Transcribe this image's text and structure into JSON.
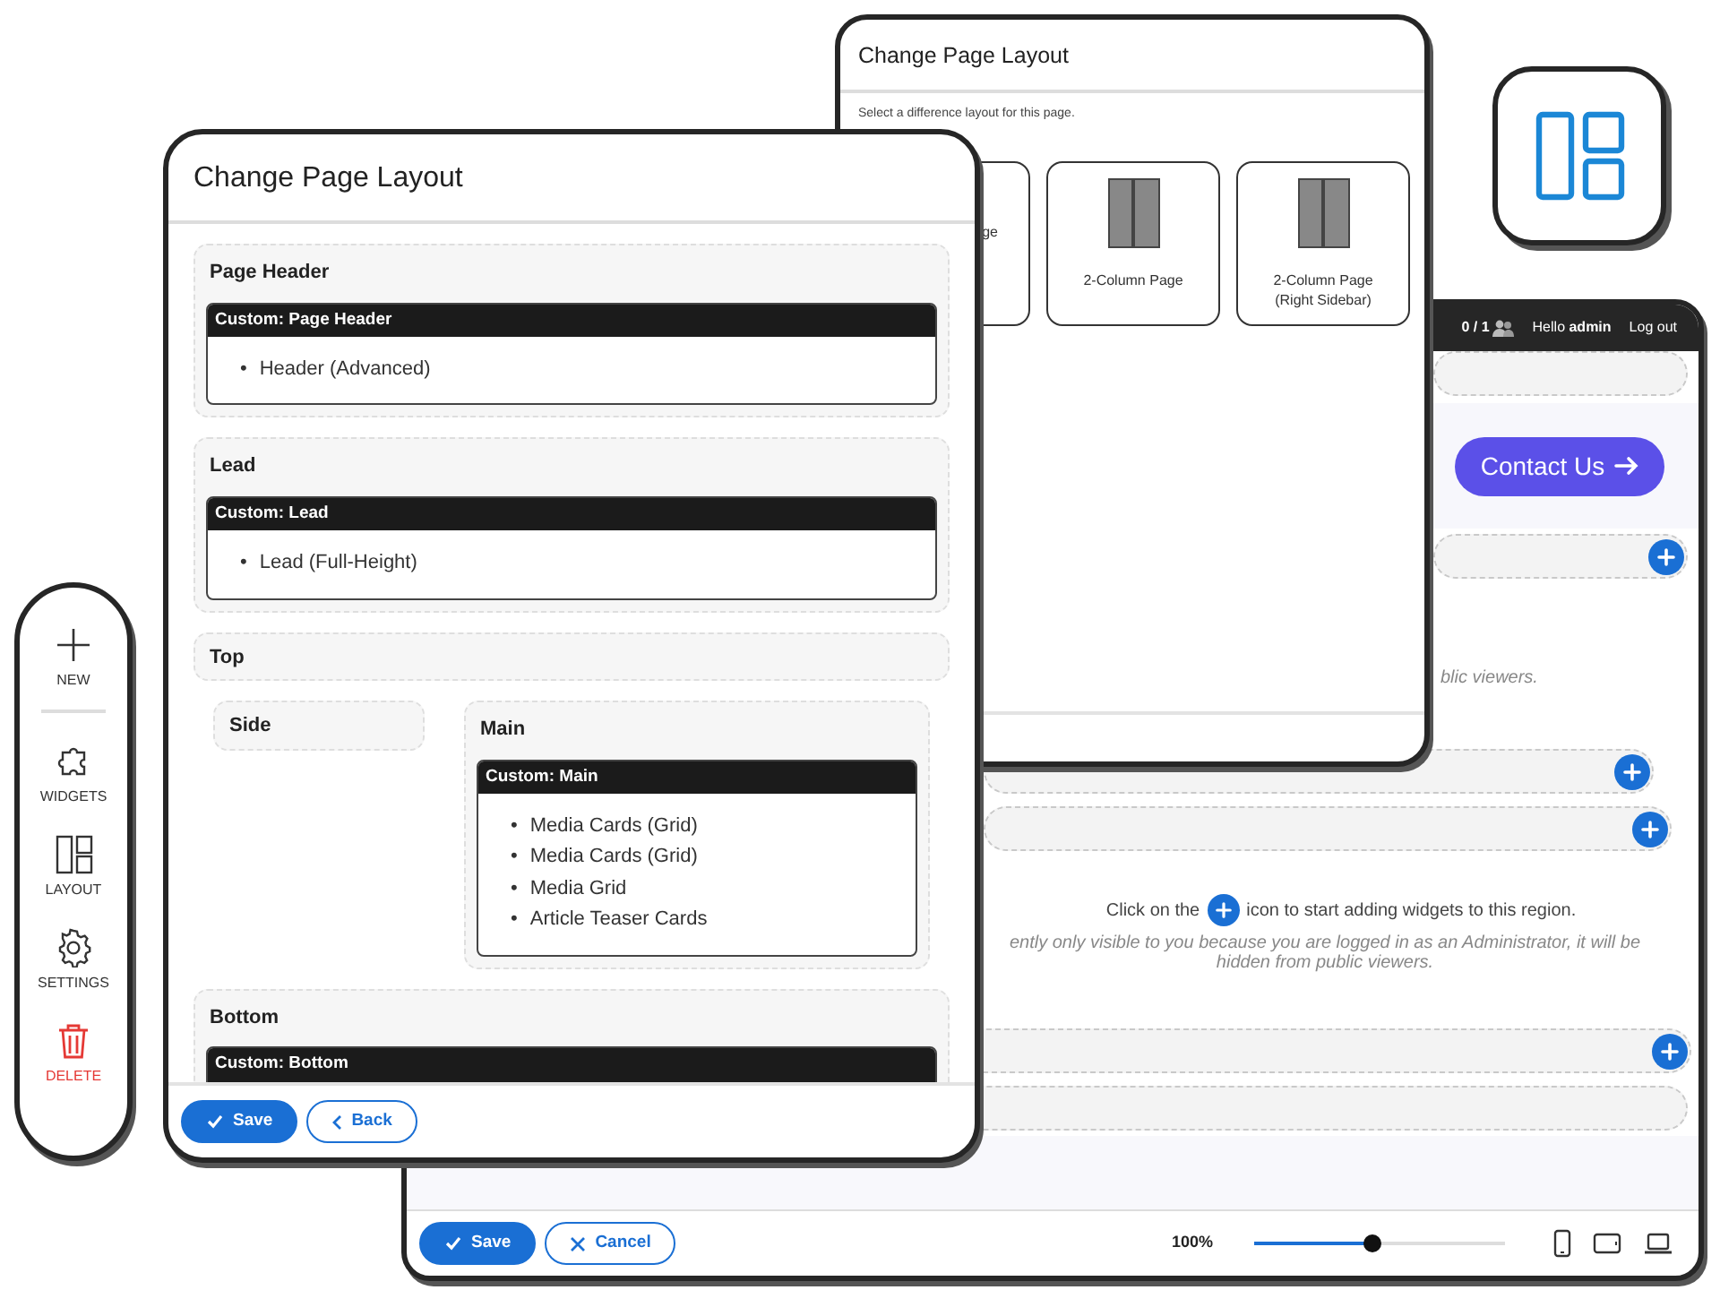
{
  "layout_picker": {
    "title": "Change Page Layout",
    "instruction": "Select a difference layout for this page.",
    "layouts": [
      {
        "label": "ge",
        "kind": "cut"
      },
      {
        "label": "2-Column Page",
        "kind": "two-column"
      },
      {
        "label": "2-Column Page (Right Sidebar)",
        "kind": "two-column"
      }
    ]
  },
  "editor": {
    "user_bar": {
      "count": "0 / 1",
      "greeting": "Hello **admin**",
      "logout": "Log out"
    },
    "contact_button": "Contact Us",
    "regions": [
      {
        "add_button": false
      },
      {
        "add_button": true
      },
      {
        "add_button": true
      },
      {
        "add_button": true
      },
      {
        "add_button": true
      },
      {
        "add_button": false
      }
    ],
    "notice_tail": "blic viewers.",
    "prompt_before": "Click on the",
    "prompt_after": "icon to start adding widgets to this region.",
    "notice": "ently only visible to you because you are logged in as an Administrator, it will be hidden from public viewers.",
    "save": "Save",
    "cancel": "Cancel",
    "zoom": "100%",
    "zoom_slider": {
      "level": 0.47
    }
  },
  "layout_dialog": {
    "title": "Change Page Layout",
    "sections": [
      {
        "kind": "region",
        "title": "Page Header",
        "widget": {
          "title": "Custom: Page Header",
          "marker": "•",
          "items": [
            "Header (Advanced)"
          ]
        }
      },
      {
        "kind": "region",
        "title": "Lead",
        "widget": {
          "title": "Custom: Lead",
          "marker": "•",
          "items": [
            "Lead (Full-Height)"
          ]
        }
      },
      {
        "kind": "region",
        "title": "Top"
      },
      {
        "kind": "columns",
        "columns": [
          {
            "title": "Side"
          },
          {
            "title": "Main",
            "widget": {
              "title": "Custom: Main",
              "marker": "•",
              "items": [
                "Media Cards (Grid)",
                "Media Cards (Grid)",
                "Media Grid",
                "Article Teaser Cards"
              ]
            }
          }
        ]
      },
      {
        "kind": "region",
        "title": "Bottom",
        "widget": {
          "title": "Custom: Bottom"
        }
      }
    ],
    "save": "Save",
    "back": "Back"
  },
  "toolbar": {
    "items": [
      {
        "label": "NEW",
        "kind": "new"
      },
      {
        "label": "WIDGETS",
        "kind": "widgets"
      },
      {
        "label": "LAYOUT",
        "kind": "layout"
      },
      {
        "label": "SETTINGS",
        "kind": "settings"
      },
      {
        "label": "DELETE",
        "kind": "delete"
      }
    ]
  }
}
